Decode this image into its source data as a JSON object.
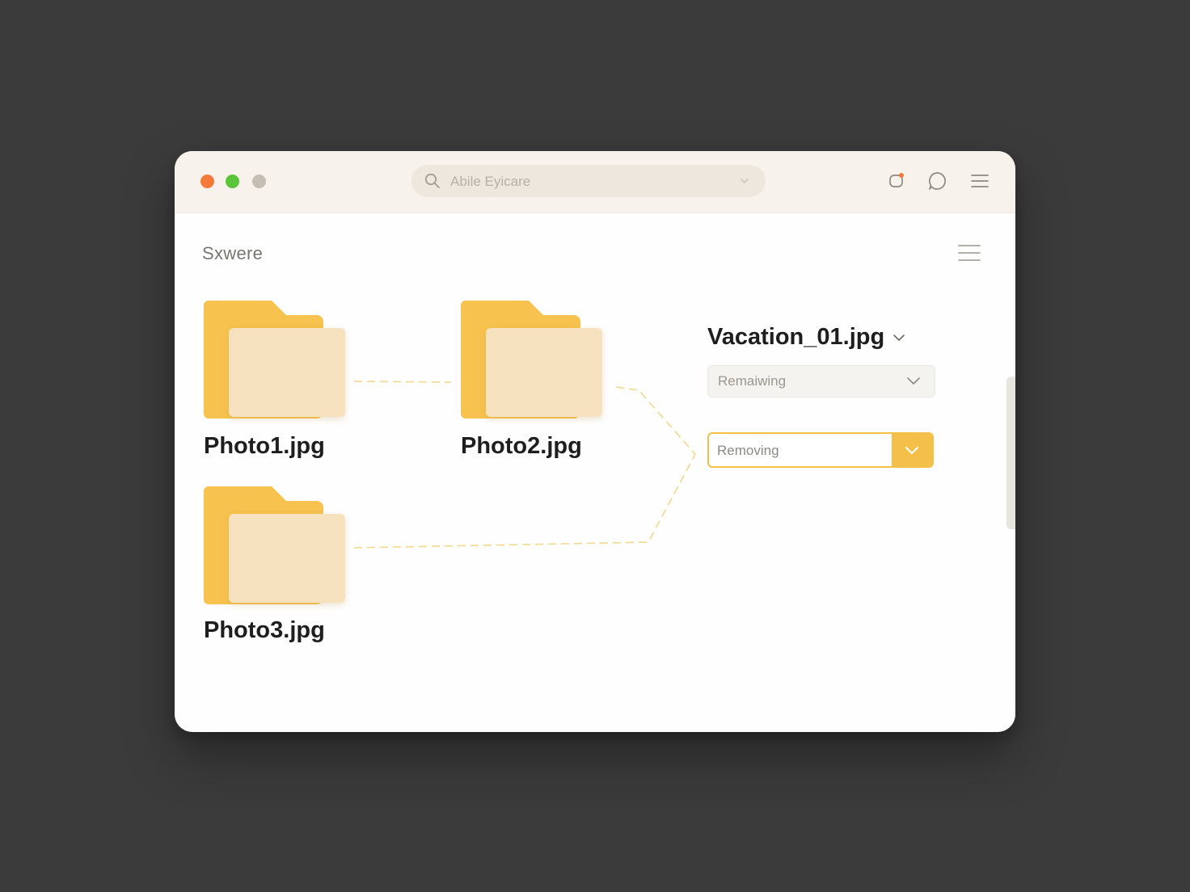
{
  "window": {
    "search": {
      "placeholder": "Abile Eyicare"
    },
    "page_title": "Sxwere"
  },
  "files": [
    {
      "name": "Photo1.jpg"
    },
    {
      "name": "Photo2.jpg"
    },
    {
      "name": "Photo3.jpg"
    }
  ],
  "panel": {
    "title": "Vacation_01.jpg",
    "muted_select_value": "Remaiwing",
    "active_select_value": "Removing"
  },
  "colors": {
    "background": "#3b3b3b",
    "traffic_red": "#f47a3c",
    "traffic_green": "#5cc43a",
    "traffic_gray": "#c5beb4",
    "folder_back": "#f7c24e",
    "folder_front": "#f7e2c0",
    "accent": "#f5c04a",
    "connector": "#f3d98a"
  },
  "icons": {
    "search": "search-icon",
    "notification": "notification-icon",
    "chat": "chat-bubble-icon",
    "menu": "hamburger-menu-icon",
    "chevron": "chevron-down-icon"
  }
}
